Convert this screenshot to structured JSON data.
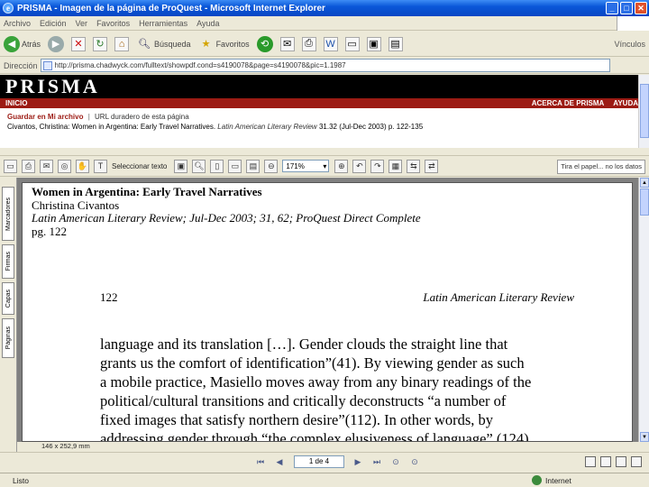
{
  "window": {
    "title": "PRISMA - Imagen de la página de ProQuest - Microsoft Internet Explorer"
  },
  "menu": [
    "Archivo",
    "Edición",
    "Ver",
    "Favoritos",
    "Herramientas",
    "Ayuda"
  ],
  "toolbar": {
    "back_label": "Atrás",
    "search_label": "Búsqueda",
    "favorites_label": "Favoritos",
    "links_label": "Vínculos"
  },
  "address": {
    "label": "Dirección",
    "url": "http://prisma.chadwyck.com/fulltext/showpdf.cond=s4190078&page=s4190078&pic=1.1987"
  },
  "prisma": {
    "logo": "PRISMA",
    "nav_home": "INICIO",
    "nav_about": "ACERCA DE PRISMA",
    "nav_help": "AYUDA",
    "save_link": "Guardar en Mi archivo",
    "url_link": "URL duradero de esta página",
    "citation_prefix": "Civantos, Christina: Women in Argentina: Early Travel Narratives.",
    "citation_journal": "Latin American Literary Review",
    "citation_suffix": "31.32 (Jul-Dec 2003) p. 122-135"
  },
  "pdf_toolbar": {
    "select_text": "Seleccionar texto",
    "zoom": "171%",
    "right_button": "Tira el papel... no los datos"
  },
  "side_tabs": [
    "Marcadores",
    "Firmas",
    "Capas",
    "Páginas"
  ],
  "document": {
    "title": "Women in Argentina: Early Travel Narratives",
    "author": "Christina Civantos",
    "source": "Latin American Literary Review; Jul-Dec 2003; 31, 62; ProQuest Direct Complete",
    "page_ref": "pg. 122",
    "page_number": "122",
    "running_head": "Latin American Literary Review",
    "body_lines": [
      "language and its translation […]. Gender clouds the straight line that",
      "grants us the comfort of identification”(41). By viewing gender as such",
      "a mobile practice, Masiello moves away from any binary readings of the",
      "political/cultural transitions and critically deconstructs “a number of",
      "fixed images that satisfy northern desire”(112). In other words, by",
      "addressing gender through “the complex elusiveness of language” (124),"
    ]
  },
  "page_size": "146 x 252,9 mm",
  "navigation": {
    "page_field": "1 de 4"
  },
  "status": {
    "left": "Listo",
    "zone": "Internet"
  }
}
